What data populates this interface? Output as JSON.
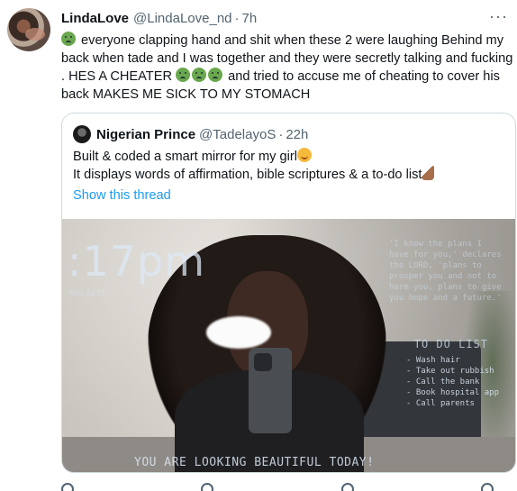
{
  "tweet": {
    "author_name": "LindaLove",
    "author_handle": "@LindaLove_nd",
    "separator": "·",
    "time": "7h",
    "more": "···",
    "text_part1": " everyone clapping hand and shit when these 2 were laughing Behind my back when tade and I was together and they were secretly talking and fucking . HES A CHEATER ",
    "text_part2": " and tried to accuse me of cheating to cover his back MAKES ME SICK TO MY STOMACH",
    "emoji_icon": "nauseated-face"
  },
  "quote": {
    "author_name": "Nigerian Prince",
    "author_handle": "@TadelayoS",
    "separator": "·",
    "time": "22h",
    "line1": "Built & coded a smart mirror for my girl",
    "line2": "It displays words of affirmation, bible scriptures & a to-do list",
    "show_thread": "Show this thread",
    "media": {
      "clock": ":17pm",
      "clock_sub": "Mon Jul 27",
      "scripture": "'I know the plans I have for you,' declares the LORD, 'plans to prosper you and not to harm you, plans to give you hope and a future.'",
      "todo_title": "TO DO LIST",
      "todo_items": [
        "- Wash hair",
        "- Take out rubbish",
        "- Call the bank",
        "- Book hospital app",
        "- Call parents"
      ],
      "affirmation": "YOU ARE LOOKING BEAUTIFUL TODAY!"
    }
  },
  "colors": {
    "accent": "#1d9bf0",
    "text": "#0f1419",
    "muted": "#536471",
    "border": "#cfd9de"
  }
}
